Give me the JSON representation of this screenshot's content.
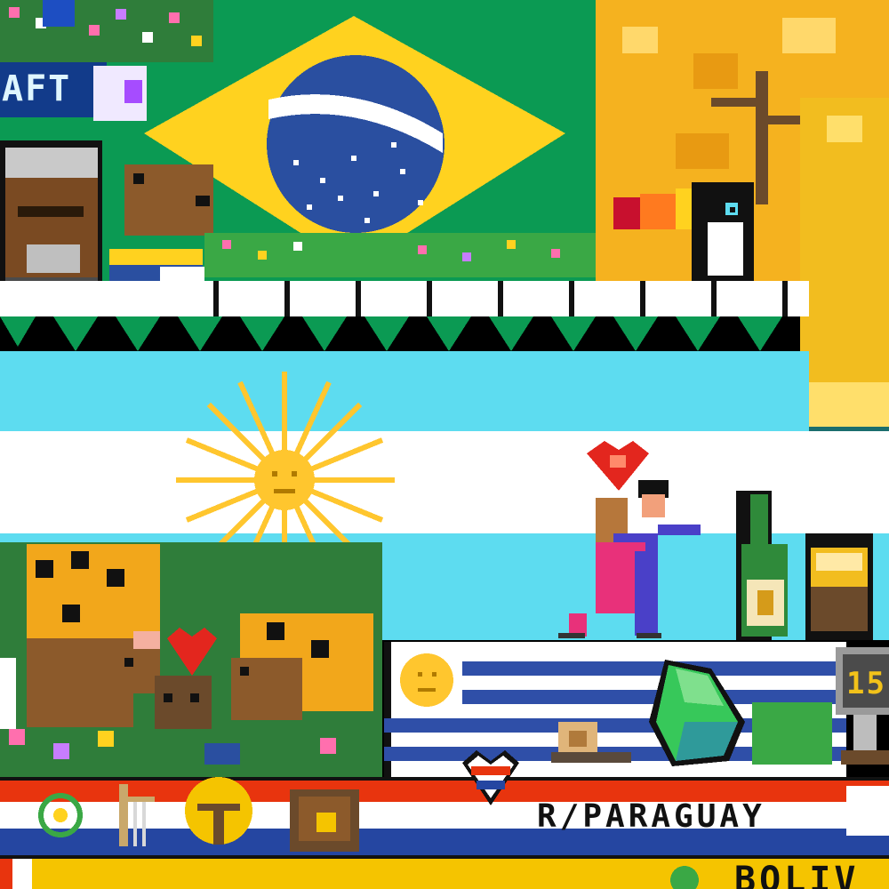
{
  "texts": {
    "craft_fragment": "AFT",
    "paraguay_label": "R/PARAGUAY",
    "bolivia_fragment": "BOLIV",
    "badge_number": "15"
  },
  "colors": {
    "brazil_green": "#0b9a53",
    "brazil_yellow": "#ffd21f",
    "brazil_blue": "#2a4fa0",
    "argentina_sky": "#5ddcf0",
    "argentina_sun": "#ffc62e",
    "uruguay_blue": "#2f4fa8",
    "paraguay_red": "#e8340e",
    "paraguay_blue": "#2546a1",
    "bolivia_yellow": "#f5c400",
    "autumn_tree": "#f5b21f",
    "toucan_beak": "#ff7a1f",
    "outline": "#111111"
  },
  "icons": [
    "brazil-flag-icon",
    "argentina-sun-icon",
    "uruguay-sun-icon",
    "toucan-icon",
    "capybara-icon",
    "heart-icon",
    "tango-dancers-icon",
    "beer-bottle-icon",
    "gourd-cup-icon",
    "paraguay-heart-icon",
    "snail-icon",
    "harp-icon",
    "tree-sign-icon",
    "jaguar-icon"
  ]
}
